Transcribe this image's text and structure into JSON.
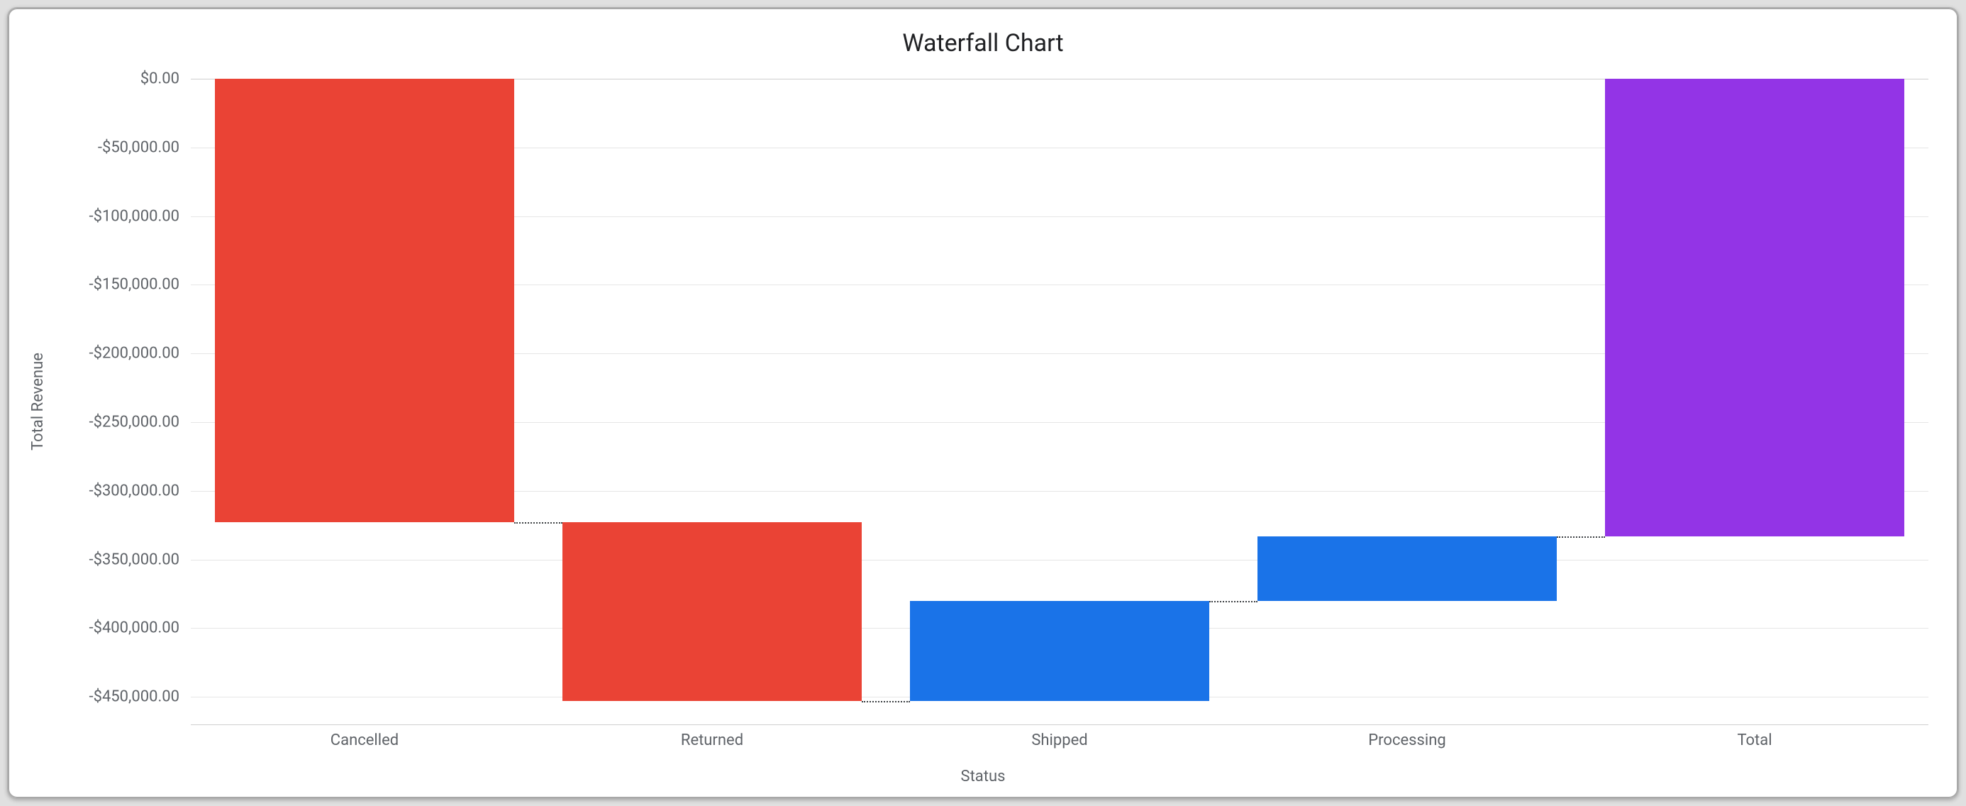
{
  "chart_data": {
    "type": "waterfall",
    "title": "Waterfall Chart",
    "xlabel": "Status",
    "ylabel": "Total Revenue",
    "ylim": [
      -470000,
      0
    ],
    "yticks": [
      0,
      -50000,
      -100000,
      -150000,
      -200000,
      -250000,
      -300000,
      -350000,
      -400000,
      -450000
    ],
    "ytick_labels": [
      "$0.00",
      "-$50,000.00",
      "-$100,000.00",
      "-$150,000.00",
      "-$200,000.00",
      "-$250,000.00",
      "-$300,000.00",
      "-$350,000.00",
      "-$400,000.00",
      "-$450,000.00"
    ],
    "categories": [
      "Cancelled",
      "Returned",
      "Shipped",
      "Processing",
      "Total"
    ],
    "bars": [
      {
        "name": "Cancelled",
        "from": 0,
        "to": -323000,
        "kind": "decrease",
        "color": "#ea4335"
      },
      {
        "name": "Returned",
        "from": -323000,
        "to": -453000,
        "kind": "decrease",
        "color": "#ea4335"
      },
      {
        "name": "Shipped",
        "from": -453000,
        "to": -380000,
        "kind": "increase",
        "color": "#1a73e8"
      },
      {
        "name": "Processing",
        "from": -380000,
        "to": -333000,
        "kind": "increase",
        "color": "#1a73e8"
      },
      {
        "name": "Total",
        "from": 0,
        "to": -333000,
        "kind": "total",
        "color": "#9334e6"
      }
    ]
  }
}
